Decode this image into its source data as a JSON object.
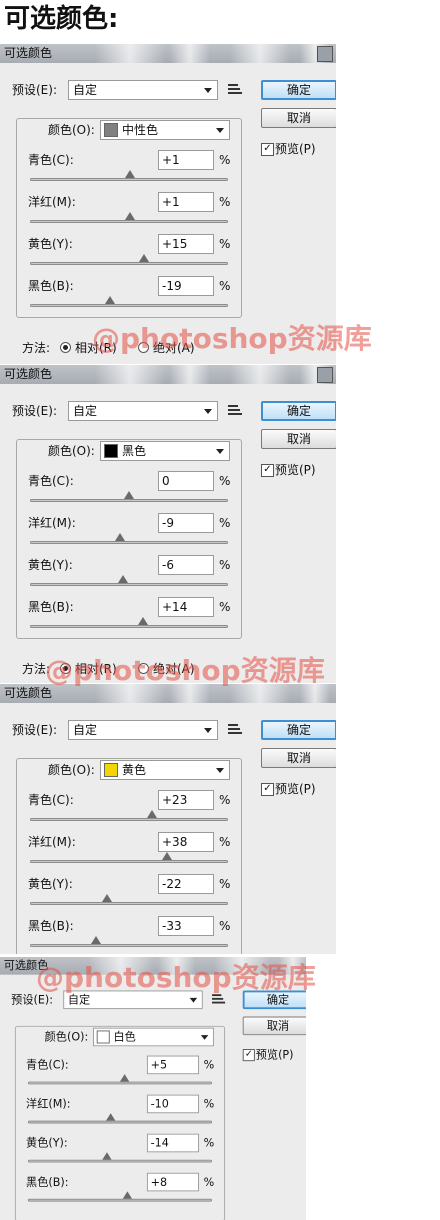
{
  "heading": "可选颜色:",
  "watermark": "@photoshop资源库",
  "dialogs": [
    {
      "title": "可选颜色",
      "preset_label": "预设(E):",
      "preset_value": "自定",
      "ok": "确定",
      "cancel": "取消",
      "preview_label": "预览(P)",
      "preview_checked": true,
      "color_label": "颜色(O):",
      "color_value": "中性色",
      "color_swatch": "#808080",
      "sliders": [
        {
          "label": "青色(C):",
          "value": "+1",
          "unit": "%",
          "pct": 1
        },
        {
          "label": "洋红(M):",
          "value": "+1",
          "unit": "%",
          "pct": 1
        },
        {
          "label": "黄色(Y):",
          "value": "+15",
          "unit": "%",
          "pct": 15
        },
        {
          "label": "黑色(B):",
          "value": "-19",
          "unit": "%",
          "pct": -19
        }
      ],
      "method_label": "方法:",
      "method_options": [
        "相对(R)",
        "绝对(A)"
      ],
      "method_selected": 0
    },
    {
      "title": "可选颜色",
      "preset_label": "预设(E):",
      "preset_value": "自定",
      "ok": "确定",
      "cancel": "取消",
      "preview_label": "预览(P)",
      "preview_checked": true,
      "color_label": "颜色(O):",
      "color_value": "黑色",
      "color_swatch": "#000000",
      "sliders": [
        {
          "label": "青色(C):",
          "value": "0",
          "unit": "%",
          "pct": 0
        },
        {
          "label": "洋红(M):",
          "value": "-9",
          "unit": "%",
          "pct": -9
        },
        {
          "label": "黄色(Y):",
          "value": "-6",
          "unit": "%",
          "pct": -6
        },
        {
          "label": "黑色(B):",
          "value": "+14",
          "unit": "%",
          "pct": 14
        }
      ],
      "method_label": "方法:",
      "method_options": [
        "相对(R)",
        "绝对(A)"
      ],
      "method_selected": 0
    },
    {
      "title": "可选颜色",
      "preset_label": "预设(E):",
      "preset_value": "自定",
      "ok": "确定",
      "cancel": "取消",
      "preview_label": "预览(P)",
      "preview_checked": true,
      "color_label": "颜色(O):",
      "color_value": "黄色",
      "color_swatch": "#f2d600",
      "sliders": [
        {
          "label": "青色(C):",
          "value": "+23",
          "unit": "%",
          "pct": 23
        },
        {
          "label": "洋红(M):",
          "value": "+38",
          "unit": "%",
          "pct": 38
        },
        {
          "label": "黄色(Y):",
          "value": "-22",
          "unit": "%",
          "pct": -22
        },
        {
          "label": "黑色(B):",
          "value": "-33",
          "unit": "%",
          "pct": -33
        }
      ]
    },
    {
      "title": "可选颜色",
      "preset_label": "预设(E):",
      "preset_value": "自定",
      "ok": "确定",
      "cancel": "取消",
      "preview_label": "预览(P)",
      "preview_checked": true,
      "color_label": "颜色(O):",
      "color_value": "白色",
      "color_swatch": "#ffffff",
      "sliders": [
        {
          "label": "青色(C):",
          "value": "+5",
          "unit": "%",
          "pct": 5
        },
        {
          "label": "洋红(M):",
          "value": "-10",
          "unit": "%",
          "pct": -10
        },
        {
          "label": "黄色(Y):",
          "value": "-14",
          "unit": "%",
          "pct": -14
        },
        {
          "label": "黑色(B):",
          "value": "+8",
          "unit": "%",
          "pct": 8
        }
      ]
    }
  ]
}
